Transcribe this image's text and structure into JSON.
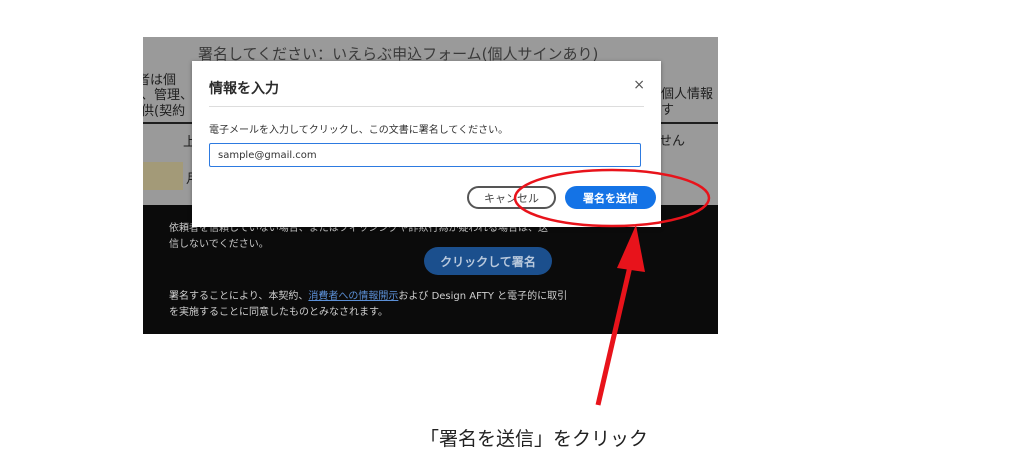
{
  "background_page": {
    "title": "署名してください：いえらぶ申込フォーム(個人サインあり)",
    "lines": [
      "者は個",
      "、管理、付",
      "供(契約",
      "個人情報",
      "す",
      "上",
      "せん",
      "月"
    ],
    "footer": {
      "warning": "依頼者を信頼していない場合、またはフィッシングや詐欺行為が疑われる場合は、送信しないでください。",
      "consent_prefix": "署名することにより、本契約、",
      "consent_link": "消費者への情報開示",
      "consent_suffix": "および Design AFTY と電子的に取引を実施することに同意したものとみなされます。",
      "sign_button": "クリックして署名"
    }
  },
  "modal": {
    "title": "情報を入力",
    "close_glyph": "×",
    "instruction": "電子メールを入力してクリックし、この文書に署名してください。",
    "email_value": "sample@gmail.com",
    "cancel_label": "キャンセル",
    "send_label": "署名を送信"
  },
  "annotation": {
    "caption": "「署名を送信」をクリック",
    "color": "#e8131b"
  },
  "colors": {
    "accent": "#1473e6",
    "dim_background": "#8f8f8f",
    "footer_bg": "#0b0b0b"
  }
}
